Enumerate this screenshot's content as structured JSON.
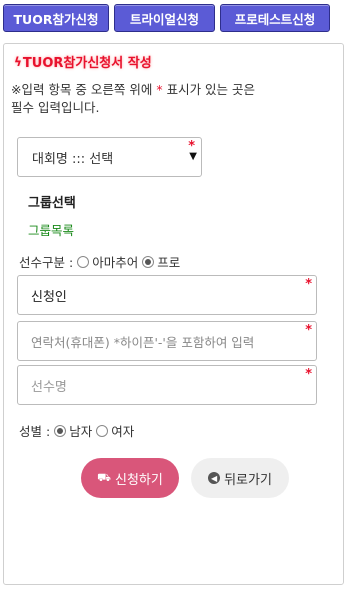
{
  "tabs": [
    {
      "label": "TUOR참가신청"
    },
    {
      "label": "트라이얼신청"
    },
    {
      "label": "프로테스트신청"
    }
  ],
  "form": {
    "title": "TUOR참가신청서 작성",
    "notice_line1_prefix": "※입력 항목 중 오른쪽 위에 ",
    "notice_star": "*",
    "notice_line1_suffix": " 표시가 있는 곳은",
    "notice_line2": "필수 입력입니다.",
    "required_mark": "*",
    "tournament_select": {
      "value": "대회명 ::: 선택"
    },
    "group_title": "그룹선택",
    "group_list": "그룹목록",
    "player_type": {
      "label": "선수구분 :",
      "options": [
        "아마추어",
        "프로"
      ],
      "selected": "프로"
    },
    "applicant": {
      "value": "신청인"
    },
    "phone": {
      "placeholder": "연락처(휴대폰) *하이픈'-'을 포함하여 입력"
    },
    "player_name": {
      "placeholder": "선수명"
    },
    "gender": {
      "label": "성별 :",
      "options": [
        "남자",
        "여자"
      ],
      "selected": "남자"
    },
    "apply_button": "신청하기",
    "back_button": "뒤로가기"
  },
  "colors": {
    "tab_bg": "#5b5bd6",
    "title_red": "#e8112d",
    "group_green": "#1a8a1a",
    "apply_bg": "#d9567a"
  },
  "icons": {
    "title": "lightning-icon",
    "apply": "car-icon",
    "back": "back-arrow-icon"
  }
}
